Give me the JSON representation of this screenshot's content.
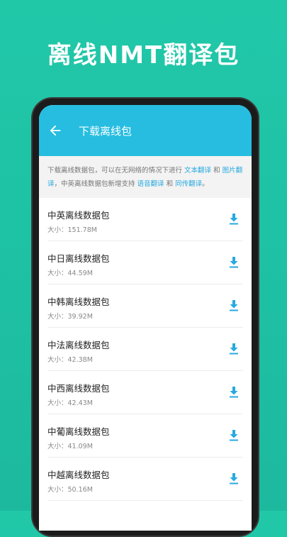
{
  "promo": {
    "title": "离线NMT翻译包"
  },
  "appbar": {
    "title": "下载离线包"
  },
  "notice": {
    "text1": "下载离线数据包，可以在无网络的情况下进行 ",
    "link1": "文本翻译",
    "text2": " 和 ",
    "link2": "图片翻译",
    "text3": "，中英离线数据包新增支持 ",
    "link3": "语音翻译",
    "text4": " 和 ",
    "link4": "同传翻译",
    "text5": "。"
  },
  "packages": [
    {
      "name": "中英离线数据包",
      "size": "大小：151.78M"
    },
    {
      "name": "中日离线数据包",
      "size": "大小：44.59M"
    },
    {
      "name": "中韩离线数据包",
      "size": "大小：39.92M"
    },
    {
      "name": "中法离线数据包",
      "size": "大小：42.38M"
    },
    {
      "name": "中西离线数据包",
      "size": "大小：42.43M"
    },
    {
      "name": "中葡离线数据包",
      "size": "大小：41.09M"
    },
    {
      "name": "中越离线数据包",
      "size": "大小：50.16M"
    }
  ],
  "icons": {
    "back": "arrow-left-icon",
    "download": "download-icon"
  },
  "colors": {
    "background": "#1ec2a5",
    "appbar": "#26bde0",
    "accent": "#27a9e0"
  }
}
